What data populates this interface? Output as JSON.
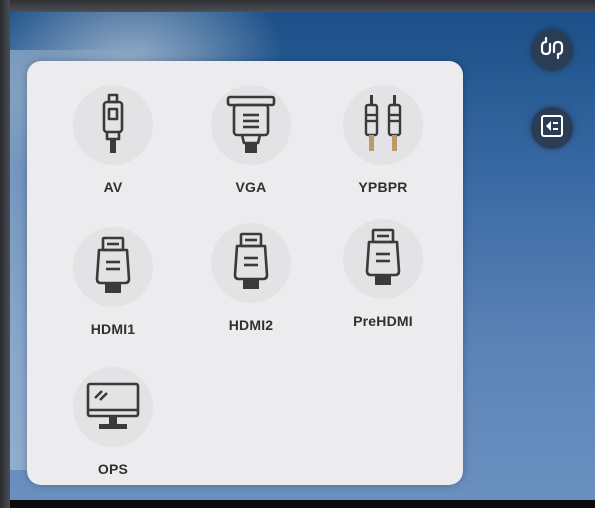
{
  "sources": [
    {
      "label": "AV",
      "icon": "av-connector-icon"
    },
    {
      "label": "VGA",
      "icon": "vga-connector-icon"
    },
    {
      "label": "YPBPR",
      "icon": "ypbpr-connector-icon"
    },
    {
      "label": "HDMI1",
      "icon": "hdmi-connector-icon"
    },
    {
      "label": "HDMI2",
      "icon": "hdmi-connector-icon"
    },
    {
      "label": "PreHDMI",
      "icon": "hdmi-connector-icon"
    },
    {
      "label": "OPS",
      "icon": "monitor-icon"
    }
  ],
  "side_buttons": [
    {
      "icon": "input-source-icon"
    },
    {
      "icon": "menu-return-icon"
    }
  ],
  "colors": {
    "panel_bg": "#ececee",
    "icon_stroke": "#3a3a3a",
    "label_text": "#303030",
    "side_button_bg": "#2a3d55"
  }
}
